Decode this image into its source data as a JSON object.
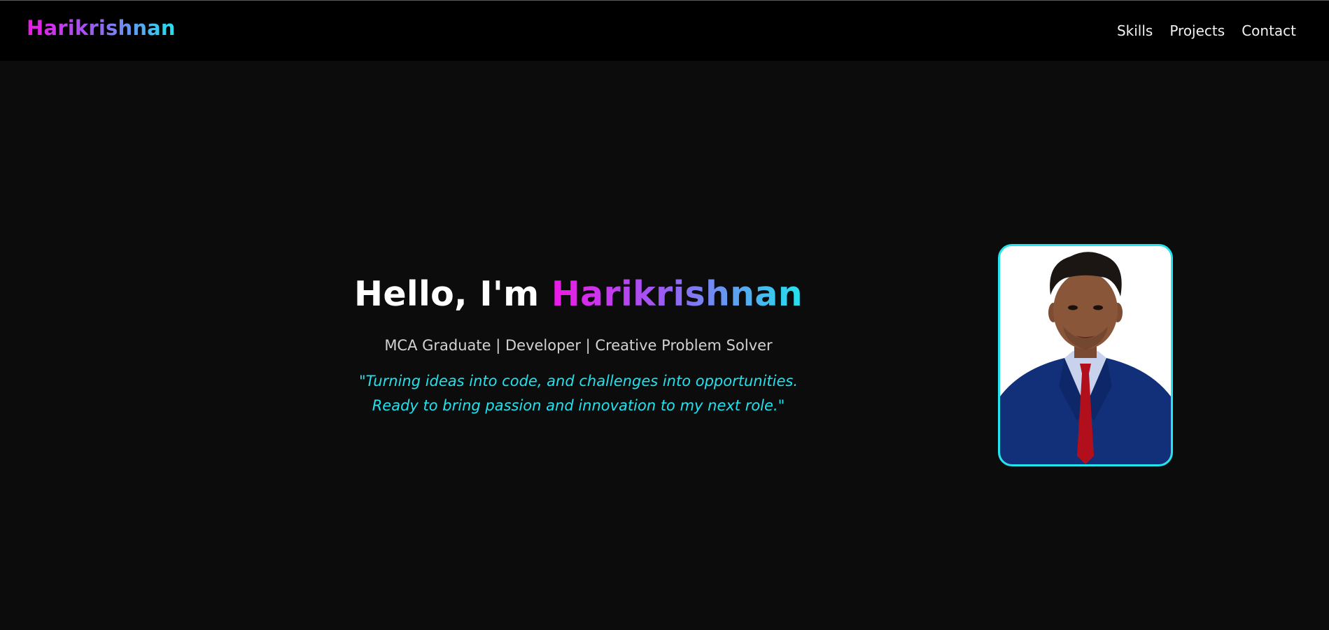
{
  "brand": "Harikrishnan",
  "nav": [
    "Skills",
    "Projects",
    "Contact"
  ],
  "hero": {
    "greeting": "Hello, I'm",
    "name": "Harikrishnan",
    "subtitle": "MCA Graduate | Developer | Creative Problem Solver",
    "quote_line1": "\"Turning ideas into code, and challenges into opportunities.",
    "quote_line2": "Ready to bring passion and innovation to my next role.\""
  },
  "colors": {
    "accent_pink": "#ee18e6",
    "accent_purple": "#9a5df4",
    "accent_cyan": "#22e3ee",
    "background": "#0c0c0c",
    "navbar": "#000000"
  },
  "icons": {
    "profile_photo": "profile-photo"
  }
}
